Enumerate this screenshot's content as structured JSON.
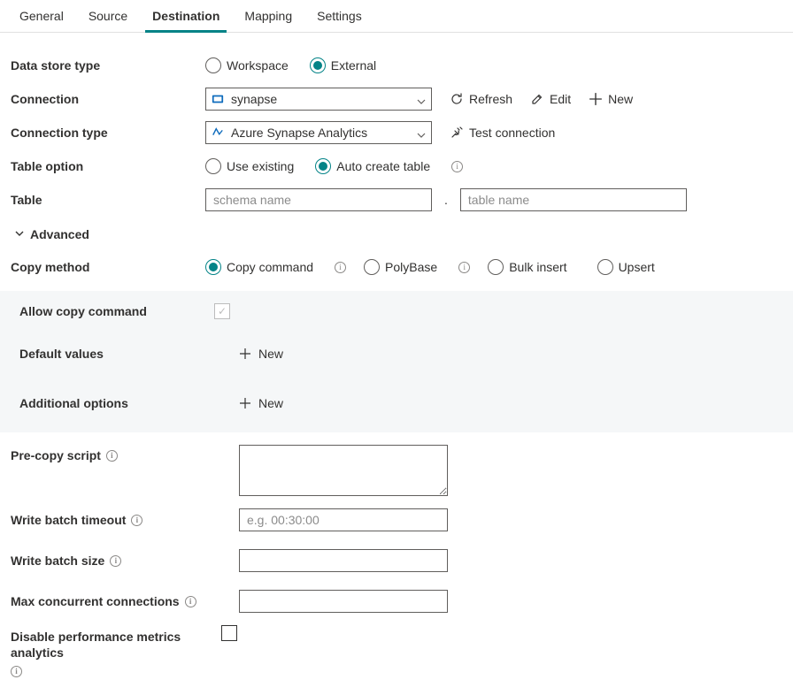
{
  "tabs": {
    "general": "General",
    "source": "Source",
    "destination": "Destination",
    "mapping": "Mapping",
    "settings": "Settings",
    "active": "destination"
  },
  "labels": {
    "dataStoreType": "Data store type",
    "connection": "Connection",
    "connectionType": "Connection type",
    "tableOption": "Table option",
    "table": "Table",
    "advanced": "Advanced",
    "copyMethod": "Copy method",
    "allowCopyCommand": "Allow copy command",
    "defaultValues": "Default values",
    "additionalOptions": "Additional options",
    "preCopyScript": "Pre-copy script",
    "writeBatchTimeout": "Write batch timeout",
    "writeBatchSize": "Write batch size",
    "maxConcurrent": "Max concurrent connections",
    "disableMetrics": "Disable performance metrics analytics"
  },
  "dataStoreType": {
    "workspace": "Workspace",
    "external": "External",
    "selected": "external"
  },
  "connection": {
    "value": "synapse",
    "actions": {
      "refresh": "Refresh",
      "edit": "Edit",
      "new": "New"
    }
  },
  "connectionType": {
    "value": "Azure Synapse Analytics",
    "testConnection": "Test connection"
  },
  "tableOption": {
    "useExisting": "Use existing",
    "autoCreate": "Auto create table",
    "selected": "autoCreate"
  },
  "table": {
    "schemaPlaceholder": "schema name",
    "tablePlaceholder": "table name",
    "schemaValue": "",
    "tableValue": ""
  },
  "copyMethod": {
    "copyCommand": "Copy command",
    "polyBase": "PolyBase",
    "bulkInsert": "Bulk insert",
    "upsert": "Upsert",
    "selected": "copyCommand"
  },
  "sub": {
    "newBtn": "New"
  },
  "inputs": {
    "preCopyScript": "",
    "writeBatchTimeoutPlaceholder": "e.g. 00:30:00",
    "writeBatchTimeout": "",
    "writeBatchSize": "",
    "maxConcurrent": ""
  },
  "colors": {
    "accent": "#038387",
    "border": "#605e5c"
  }
}
